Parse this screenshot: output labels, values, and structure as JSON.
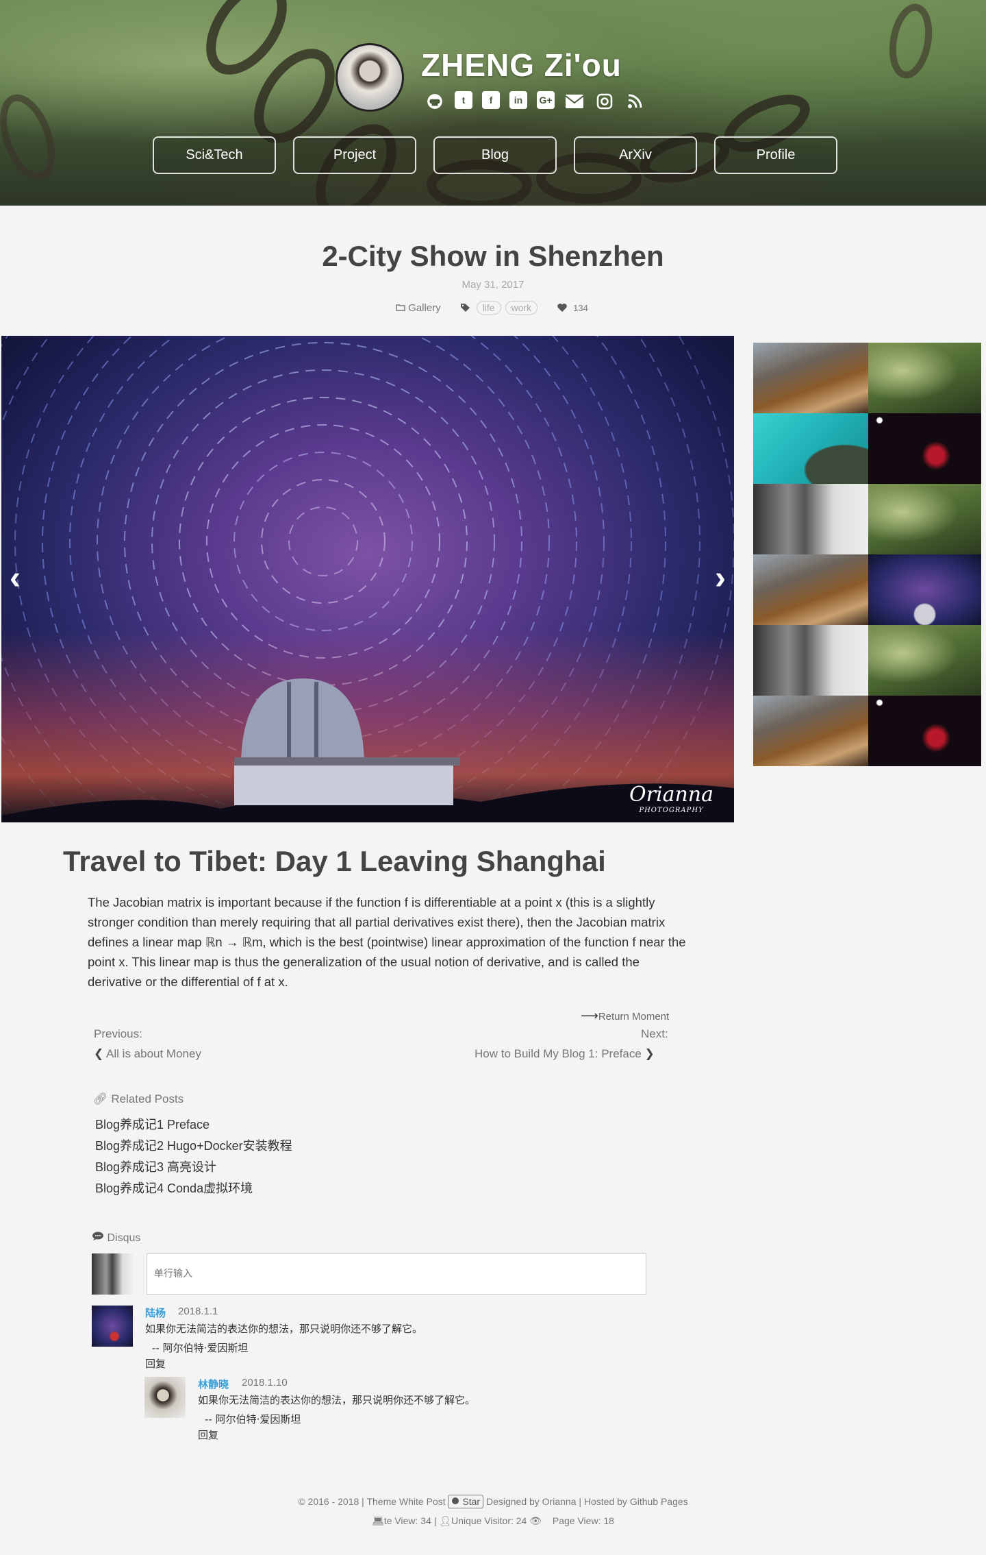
{
  "header": {
    "site_title": "ZHENG Zi'ou",
    "social_icons": [
      "github-icon",
      "twitter-icon",
      "facebook-icon",
      "linkedin-icon",
      "google-plus-icon",
      "email-icon",
      "instagram-icon",
      "rss-icon"
    ],
    "nav": [
      "Sci&Tech",
      "Project",
      "Blog",
      "ArXiv",
      "Profile"
    ]
  },
  "post": {
    "title": "2-City Show in Shenzhen",
    "date": "May 31, 2017",
    "category": "Gallery",
    "tags": [
      "life",
      "work"
    ],
    "likes": "134"
  },
  "hero": {
    "watermark_line1": "Orianna",
    "watermark_line2": "PHOTOGRAPHY",
    "prev_arrow": "‹",
    "next_arrow": "›"
  },
  "article": {
    "title": "Travel to Tibet: Day 1 Leaving Shanghai",
    "body": "The Jacobian matrix is important because if the function f is differentiable at a point x (this is a slightly stronger condition than merely requiring that all partial derivatives exist there), then the Jacobian matrix defines a linear map ℝn → ℝm, which is the best (pointwise) linear approximation of the function f near the point x. This linear map is thus the generalization of the usual notion of derivative, and is called the derivative or the differential of f at x."
  },
  "navigation": {
    "return_label": "Return Moment",
    "previous_label": "Previous:",
    "next_label": "Next:",
    "previous_title": "All is about Money",
    "next_title": "How to Build My Blog 1: Preface"
  },
  "related": {
    "heading": "Related Posts",
    "items": [
      "Blog养成记1 Preface",
      "Blog养成记2 Hugo+Docker安装教程",
      "Blog养成记3 高亮设计",
      "Blog养成记4 Conda虚拟环境"
    ]
  },
  "comments": {
    "heading": "Disqus",
    "input_placeholder": "单行输入",
    "items": [
      {
        "name": "陆杨",
        "date": "2018.1.1",
        "text": "如果你无法简洁的表达你的想法，那只说明你还不够了解它。",
        "attribution": "-- 阿尔伯特·爱因斯坦",
        "reply": "回复"
      },
      {
        "name": "林静晓",
        "date": "2018.1.10",
        "text": "如果你无法简洁的表达你的想法，那只说明你还不够了解它。",
        "attribution": "-- 阿尔伯特·爱因斯坦",
        "reply": "回复"
      }
    ]
  },
  "footer": {
    "copyright": "© 2016 - 2018 | Theme White Post",
    "star_label": "Star",
    "designed_by": "Designed by Orianna |  Hosted by Github Pages",
    "site_view": "te View: 34 |",
    "unique_visitor": "Unique Visitor: 24",
    "page_view": "Page View: 18"
  }
}
